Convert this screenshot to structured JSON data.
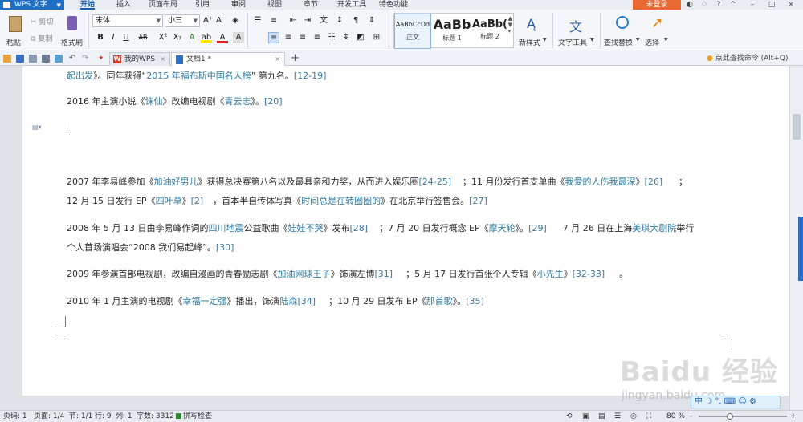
{
  "app": {
    "name": "WPS 文字",
    "login": "未登录"
  },
  "menu": {
    "tabs": [
      "开始",
      "插入",
      "页面布局",
      "引用",
      "审阅",
      "视图",
      "章节",
      "开发工具",
      "特色功能"
    ],
    "active": "开始"
  },
  "ribbon": {
    "paste": "粘贴",
    "cut": "剪切",
    "copy": "复制",
    "format_painter": "格式刷",
    "font_name": "宋体",
    "font_size": "小三",
    "styles": [
      {
        "sample": "AaBbCcDd",
        "name": "正文"
      },
      {
        "sample": "AaBb",
        "name": "标题 1"
      },
      {
        "sample": "AaBb(",
        "name": "标题 2"
      }
    ],
    "new_style": "新样式",
    "text_tools": "文字工具",
    "find_replace": "查找替换",
    "select": "选择"
  },
  "doc_tabs": [
    {
      "label": "我的WPS"
    },
    {
      "label": "文档1 *"
    }
  ],
  "command_search": "点此查找命令 (Alt+Q)",
  "document": {
    "p0": {
      "a": "起出发",
      "b": "》。同年获得“",
      "link": "2015 年福布斯中国名人榜",
      "c": "” 第九名。",
      "ref": "[12-19]"
    },
    "p1": {
      "a": "2016 年主演小说《",
      "l1": "诛仙",
      "b": "》改编电视剧《",
      "l2": "青云志",
      "c": "》。",
      "ref": "[20]"
    },
    "p2a": {
      "a": "2007 年李易峰参加《",
      "l1": "加油好男儿",
      "b": "》获得总决赛第八名以及最具亲和力奖，从而进入娱乐圈",
      "r1": "[24-25]",
      "c": "；11 月份发行首支单曲《",
      "l2": "我爱的人伤我最深",
      "d": "》",
      "r2": "[26]",
      "e": "；"
    },
    "p2b": {
      "a": "12 月 15 日发行 EP《",
      "l1": "四叶草",
      "b": "》",
      "r1": "[2]",
      "c": "，首本半自传体写真《",
      "l2": "时间总是在转圈圈的",
      "d": "》在北京举行签售会。",
      "r2": "[27]"
    },
    "p3a": {
      "a": "2008 年 5 月 13 日由李易峰作词的",
      "l1": "四川地震",
      "b": "公益歌曲《",
      "l2": "娃娃不哭",
      "c": "》发布",
      "r1": "[28]",
      "d": "；7 月 20 日发行概念 EP《",
      "l3": "摩天轮",
      "e": "》。",
      "r2": "[29]",
      "f": "7 月 26 日在上海",
      "l4": "美琪大剧院",
      "g": "举行"
    },
    "p3b": {
      "a": "个人首场演唱会“2008 我们易起峰”。",
      "r1": "[30]"
    },
    "p4": {
      "a": "2009 年参演首部电视剧，改编自漫画的青春励志剧《",
      "l1": "加油网球王子",
      "b": "》饰演左博",
      "r1": "[31]",
      "c": "；5 月 17 日发行首张个人专辑《",
      "l2": "小先生",
      "d": "》",
      "r2": "[32-33]",
      "e": "。"
    },
    "p5": {
      "a": "2010 年 1 月主演的电视剧《",
      "l1": "幸福一定强",
      "b": "》播出，饰演",
      "l2": "陆森",
      "r1": "[34]",
      "c": "；10 月 29 日发布 EP《",
      "l3": "那首歌",
      "d": "》。",
      "r2": "[35]"
    }
  },
  "watermark": {
    "brand": "Baidu 经验",
    "url": "jingyan.baidu.com"
  },
  "ime": {
    "label": "中"
  },
  "status": {
    "page_num": "页码: 1",
    "pages": "页面: 1/4",
    "section": "节: 1/1",
    "row": "行: 9",
    "col": "列: 1",
    "words": "字数: 3312",
    "spell": "拼写检查",
    "zoom": "80 %"
  },
  "colors": {
    "accent": "#1f6fc5",
    "login": "#e86a32",
    "link": "#2d7aa0"
  }
}
